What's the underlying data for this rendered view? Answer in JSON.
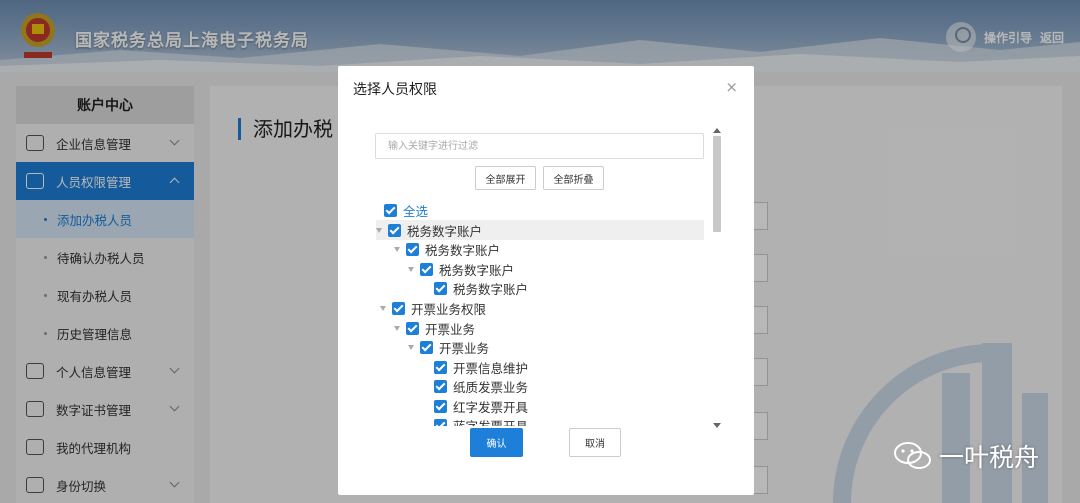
{
  "header": {
    "site_title": "国家税务总局上海电子税务局",
    "guide_label": "操作引导",
    "back_label": "返回"
  },
  "sidebar": {
    "title": "账户中心",
    "items": [
      {
        "label": "企业信息管理",
        "icon": "building-icon"
      },
      {
        "label": "人员权限管理",
        "icon": "user-search-icon"
      },
      {
        "label": "个人信息管理",
        "icon": "id-card-icon"
      },
      {
        "label": "数字证书管理",
        "icon": "certificate-icon"
      },
      {
        "label": "我的代理机构",
        "icon": "agency-icon"
      },
      {
        "label": "身份切换",
        "icon": "switch-icon"
      }
    ],
    "subitems": [
      "添加办税人员",
      "待确认办税人员",
      "现有办税人员",
      "历史管理信息"
    ]
  },
  "main": {
    "page_title": "添加办税"
  },
  "modal": {
    "title": "选择人员权限",
    "close": "×",
    "filter_placeholder": "输入关键字进行过滤",
    "expand_all": "全部展开",
    "collapse_all": "全部折叠",
    "select_all": "全选",
    "tree": [
      {
        "label": "税务数字账户",
        "level": 0,
        "caret": true
      },
      {
        "label": "税务数字账户",
        "level": 1,
        "caret": true
      },
      {
        "label": "税务数字账户",
        "level": 2,
        "caret": true
      },
      {
        "label": "税务数字账户",
        "level": 3,
        "caret": false
      },
      {
        "label": "开票业务权限",
        "level": 0,
        "caret": true
      },
      {
        "label": "开票业务",
        "level": 1,
        "caret": true
      },
      {
        "label": "开票业务",
        "level": 2,
        "caret": true
      },
      {
        "label": "开票信息维护",
        "level": 3,
        "caret": false
      },
      {
        "label": "纸质发票业务",
        "level": 3,
        "caret": false
      },
      {
        "label": "红字发票开具",
        "level": 3,
        "caret": false
      },
      {
        "label": "蓝字发票开具",
        "level": 3,
        "caret": false
      }
    ],
    "confirm": "确认",
    "cancel": "取消"
  },
  "watermark": {
    "text": "一叶税舟"
  },
  "colors": {
    "accent": "#1e7fd8",
    "header": "#7a98bc"
  }
}
